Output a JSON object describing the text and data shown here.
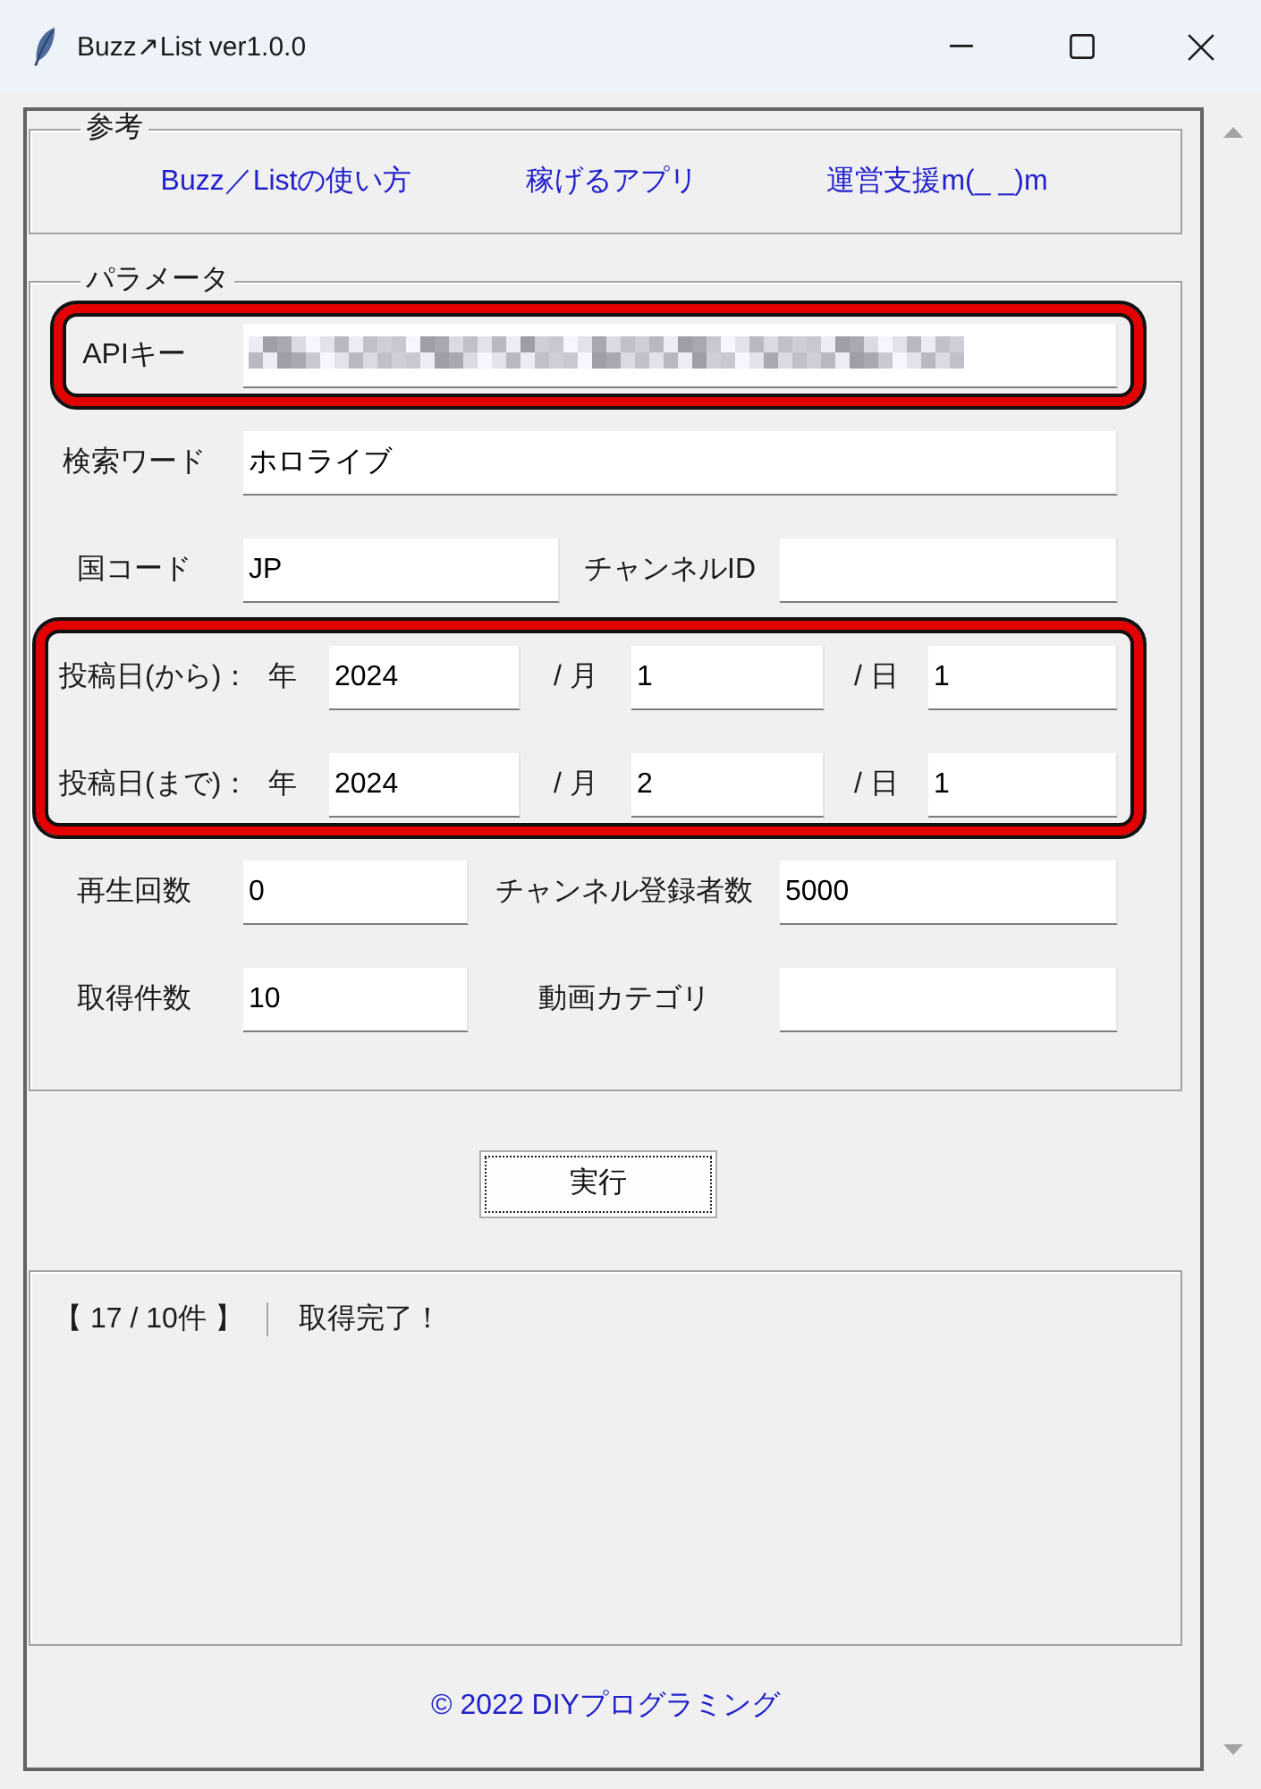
{
  "window": {
    "title": "Buzz↗List ver1.0.0"
  },
  "reference": {
    "title": "参考",
    "links": [
      "Buzz／Listの使い方",
      "稼げるアプリ",
      "運営支援m(_ _)m"
    ]
  },
  "parameters": {
    "title": "パラメータ",
    "groups": [
      {
        "highlighted": true,
        "rows": [
          {
            "kind": "wide",
            "label": "APIキー",
            "field": {
              "redacted": true
            }
          }
        ]
      },
      {
        "highlighted": false,
        "rows": [
          {
            "kind": "wide",
            "label": "検索ワード",
            "field": {
              "value": "ホロライブ"
            }
          },
          {
            "kind": "pair",
            "fields": [
              {
                "label": "国コード",
                "value": "JP"
              },
              {
                "label": "チャンネルID"
              }
            ]
          }
        ]
      },
      {
        "highlighted": true,
        "rows": [
          {
            "kind": "date",
            "label": "投稿日(から)：",
            "parts": [
              {
                "unit": "年",
                "value": "2024"
              },
              {
                "unit": "/ 月",
                "value": "1"
              },
              {
                "unit": "/ 日",
                "value": "1"
              }
            ]
          },
          {
            "kind": "date",
            "label": "投稿日(まで)：",
            "parts": [
              {
                "unit": "年",
                "value": "2024"
              },
              {
                "unit": "/ 月",
                "value": "2"
              },
              {
                "unit": "/ 日",
                "value": "1"
              }
            ]
          }
        ]
      },
      {
        "highlighted": false,
        "rows": [
          {
            "kind": "pair",
            "fields": [
              {
                "label": "再生回数",
                "value": "0"
              },
              {
                "label": "チャンネル登録者数",
                "value": "5000"
              }
            ]
          },
          {
            "kind": "pair",
            "fields": [
              {
                "label": "取得件数",
                "value": "10"
              },
              {
                "label": "動画カテゴリ"
              }
            ]
          }
        ]
      }
    ]
  },
  "run_button": {
    "label": "実行"
  },
  "output": {
    "count": "【 17 / 10件 】",
    "message": "取得完了！"
  },
  "footer": {
    "copyright": "© 2022 DIYプログラミング"
  }
}
